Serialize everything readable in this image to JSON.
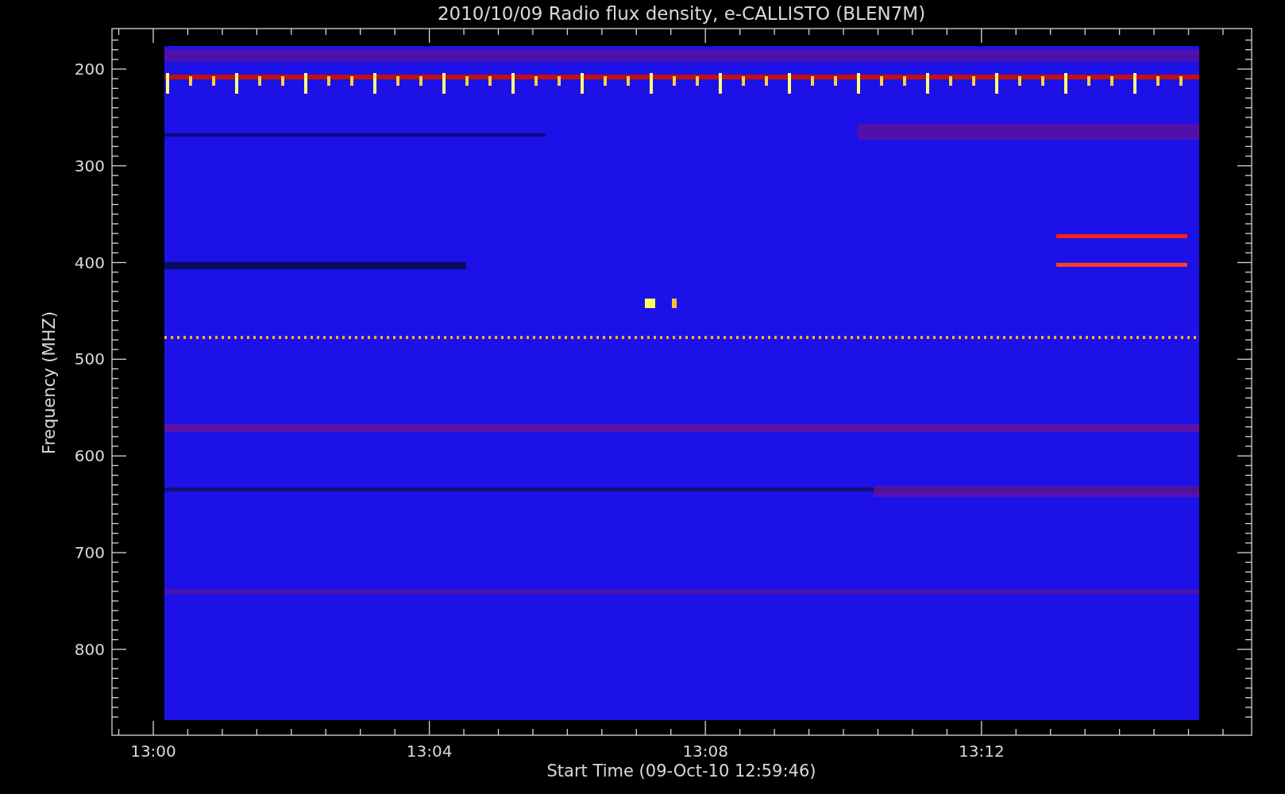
{
  "title": "2010/10/09  Radio flux density, e-CALLISTO (BLEN7M)",
  "y_axis": {
    "label": "Frequency (MHZ)",
    "ticks": [
      "200",
      "300",
      "400",
      "500",
      "600",
      "700",
      "800"
    ]
  },
  "x_axis": {
    "label": "Start Time (09-Oct-10 12:59:46)",
    "ticks": [
      "13:00",
      "13:04",
      "13:08",
      "13:12"
    ]
  }
}
